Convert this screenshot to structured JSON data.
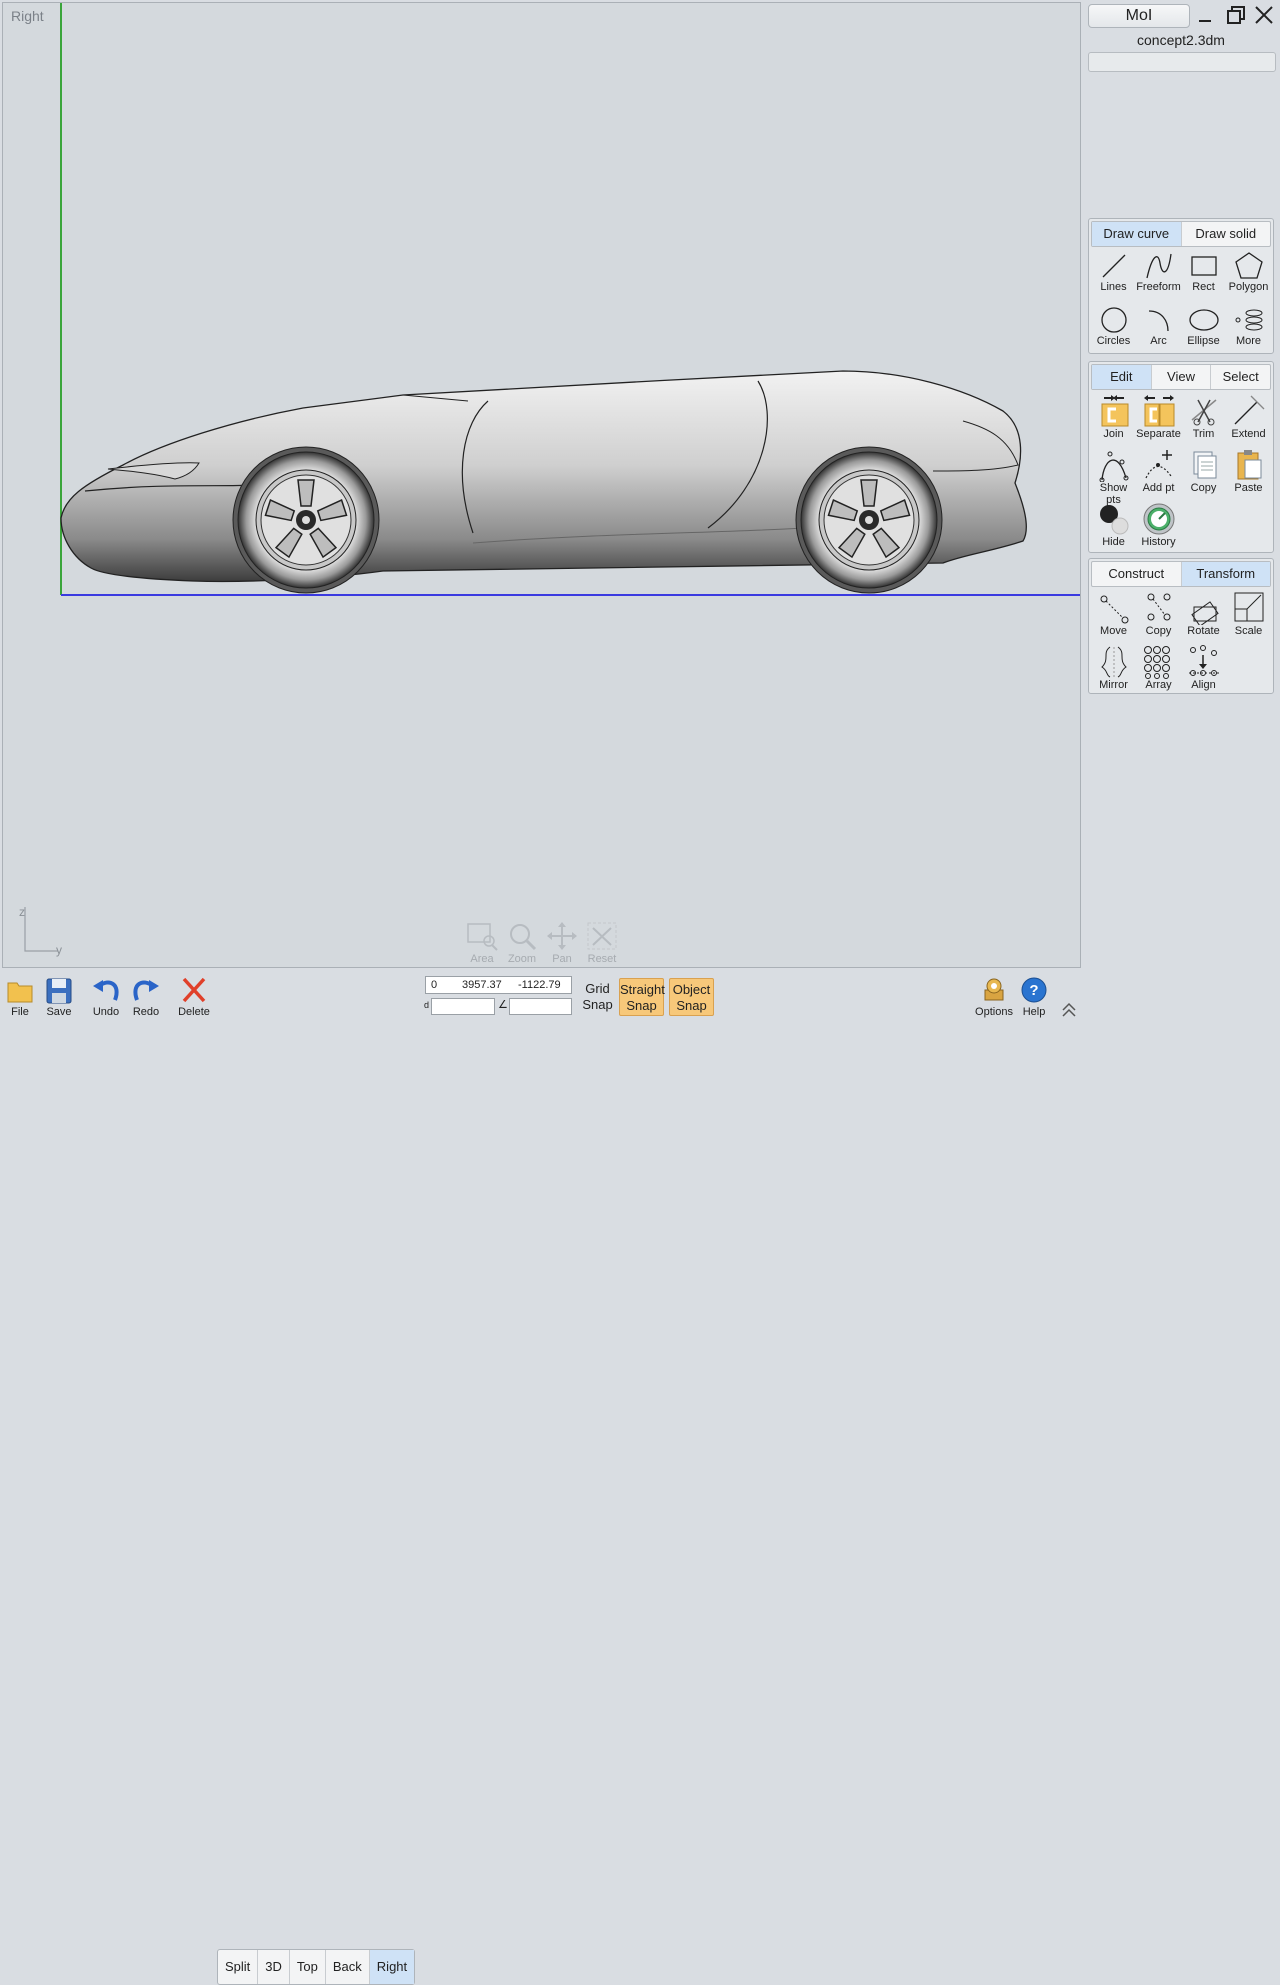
{
  "viewport": {
    "label": "Right",
    "axis_z": "z",
    "axis_y": "y"
  },
  "nav_tools": [
    {
      "label": "Area"
    },
    {
      "label": "Zoom"
    },
    {
      "label": "Pan"
    },
    {
      "label": "Reset"
    }
  ],
  "panel": {
    "title": "MoI",
    "filename": "concept2.3dm",
    "draw_group": {
      "tabs": [
        "Draw curve",
        "Draw solid"
      ],
      "tools": [
        "Lines",
        "Freeform",
        "Rect",
        "Polygon",
        "Circles",
        "Arc",
        "Ellipse",
        "More"
      ]
    },
    "edit_group": {
      "tabs": [
        "Edit",
        "View",
        "Select"
      ],
      "tools": [
        "Join",
        "Separate",
        "Trim",
        "Extend",
        "Show pts",
        "Add pt",
        "Copy",
        "Paste",
        "Hide",
        "History"
      ]
    },
    "transform_group": {
      "tabs": [
        "Construct",
        "Transform"
      ],
      "tools": [
        "Move",
        "Copy",
        "Rotate",
        "Scale",
        "Mirror",
        "Array",
        "Align"
      ]
    }
  },
  "bottom": {
    "file": "File",
    "save": "Save",
    "undo": "Undo",
    "redo": "Redo",
    "delete": "Delete",
    "views": [
      "Split",
      "3D",
      "Top",
      "Back",
      "Right"
    ],
    "coord": {
      "c0": "0",
      "c1": "3957.37",
      "c2": "-1122.79"
    },
    "d_label": "d",
    "angle_label": "∠",
    "grid_snap": [
      "Grid",
      "Snap"
    ],
    "straight_snap": [
      "Straight",
      "Snap"
    ],
    "object_snap": [
      "Object",
      "Snap"
    ],
    "options": "Options",
    "help": "Help"
  },
  "colors": {
    "active_tab": "#cfe2f6",
    "snap_on": "#f7c87a",
    "y_axis": "#3aa53a",
    "x_axis": "#3a3ae0"
  }
}
